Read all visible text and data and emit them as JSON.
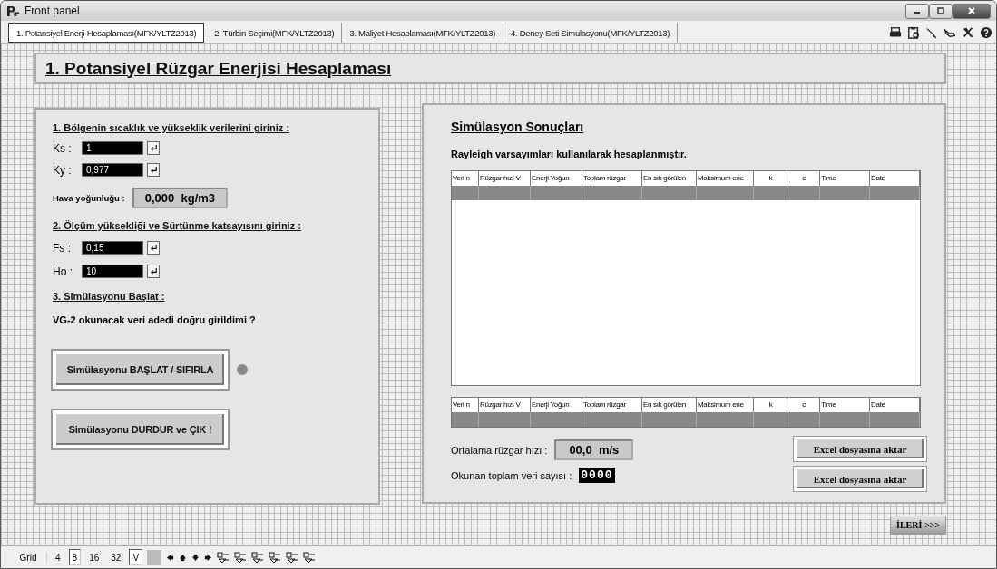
{
  "window": {
    "title": "Front panel"
  },
  "tabs": [
    {
      "label": "1. Potansiyel Enerji Hesaplaması(MFK/YLTZ2013)",
      "selected": true
    },
    {
      "label": "2. Türbin Seçimi(MFK/YLTZ2013)",
      "selected": false
    },
    {
      "label": "3. Maliyet Hesaplaması(MFK/YLTZ2013)",
      "selected": false
    },
    {
      "label": "4. Deney Seti Simulasyonu(MFK/YLTZ2013)",
      "selected": false
    }
  ],
  "page_title": "1. Potansiyel Rüzgar Enerjisi Hesaplaması",
  "inputs_panel": {
    "section_1": "1. Bölgenin sıcaklık ve yükseklik verilerini giriniz :",
    "fields_1": [
      {
        "label": "Ks :",
        "value": "1"
      },
      {
        "label": "Ky :",
        "value": "0,977"
      }
    ],
    "air_density": {
      "label": "Hava yoğunluğu :",
      "value": "0,000  kg/m3"
    },
    "section_2": "2. Ölçüm yüksekliği ve Sürtünme katsayısını giriniz :",
    "fields_2": [
      {
        "label": "Fs :",
        "value": "0,15"
      },
      {
        "label": "Ho :",
        "value": "10"
      }
    ],
    "section_3": "3. Simülasyonu Başlat :",
    "question": "VG-2 okunacak veri adedi doğru girildimi ?",
    "start_button": "Simülasyonu BAŞLAT / SIFIRLA",
    "led_on": false,
    "stop_button": "Simülasyonu DURDUR ve ÇIK !"
  },
  "results_panel": {
    "title": "Simülasyon Sonuçları",
    "subtitle": "Rayleigh varsayımları kullanılarak hesaplanmıştır.",
    "tables": [
      {
        "columns": [
          "Veri n",
          "Rüzgar hızı V",
          "Enerji Yoğun",
          "Toplam rüzgar",
          "En sık görülen",
          "Maksimum ene",
          "k",
          "c",
          "Time",
          "Date"
        ]
      },
      {
        "columns": [
          "Veri n",
          "Rüzgar hızı V",
          "Enerji Yoğun",
          "Toplam rüzgar",
          "En sık görülen",
          "Maksimum ene",
          "k",
          "c",
          "Time",
          "Date"
        ]
      }
    ],
    "mean_speed": {
      "label": "Ortalama rüzgar hızı :",
      "value": "00,0  m/s"
    },
    "count": {
      "label": "Okunan toplam veri sayısı :",
      "value": "0000"
    },
    "export_buttons": [
      "Excel dosyasına aktar",
      "Excel dosyasına aktar"
    ]
  },
  "next_button": "İLERİ >>>",
  "grid_bar": {
    "label": "Grid",
    "options": [
      {
        "label": "4",
        "selected": false
      },
      {
        "label": "8",
        "selected": true
      },
      {
        "label": "16",
        "selected": false
      },
      {
        "label": "32",
        "selected": false
      },
      {
        "label": "V",
        "selected": true
      }
    ]
  }
}
